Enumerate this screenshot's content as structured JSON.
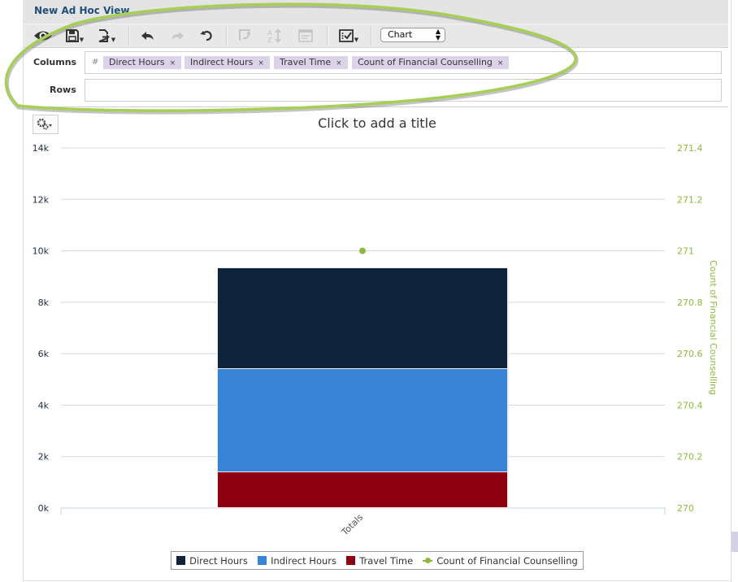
{
  "window": {
    "title": "New Ad Hoc View"
  },
  "toolbar": {
    "buttons": [
      {
        "name": "view-icon",
        "label": "Display mode"
      },
      {
        "name": "save-icon",
        "label": "Save"
      },
      {
        "name": "export-icon",
        "label": "Export"
      },
      {
        "name": "undo-icon",
        "label": "Undo"
      },
      {
        "name": "redo-icon",
        "label": "Redo"
      },
      {
        "name": "reset-icon",
        "label": "Undo all"
      },
      {
        "name": "pivot-icon",
        "label": "Pivot"
      },
      {
        "name": "sort-icon",
        "label": "Sort"
      },
      {
        "name": "input-controls-icon",
        "label": "Input controls"
      },
      {
        "name": "options-icon",
        "label": "Options"
      }
    ],
    "view_type": {
      "selected": "Chart"
    }
  },
  "shelves": {
    "columns_label": "Columns",
    "rows_label": "Rows",
    "columns_marker": "#",
    "columns": [
      {
        "label": "Direct Hours",
        "remove": "×"
      },
      {
        "label": "Indirect Hours",
        "remove": "×"
      },
      {
        "label": "Travel Time",
        "remove": "×"
      },
      {
        "label": "Count of Financial Counselling",
        "remove": "×"
      }
    ],
    "rows": []
  },
  "chart_title_placeholder": "Click to add a title",
  "chart_data": {
    "type": "bar",
    "stacked": true,
    "title": "Click to add a title",
    "categories": [
      "Totals"
    ],
    "series": [
      {
        "name": "Direct Hours",
        "type": "bar",
        "axis": "left",
        "color": "#0f233a",
        "values": [
          3919
        ]
      },
      {
        "name": "Indirect Hours",
        "type": "bar",
        "axis": "left",
        "color": "#3883d6",
        "values": [
          4014
        ]
      },
      {
        "name": "Travel Time",
        "type": "bar",
        "axis": "left",
        "color": "#8c0010",
        "values": [
          1390
        ]
      },
      {
        "name": "Count of Financial Counselling",
        "type": "line",
        "axis": "right",
        "color": "#8cba3c",
        "values": [
          271
        ]
      }
    ],
    "left_axis": {
      "min": 0,
      "max": 14000,
      "ticks": [
        0,
        2000,
        4000,
        6000,
        8000,
        10000,
        12000,
        14000
      ],
      "tick_labels": [
        "0k",
        "2k",
        "4k",
        "6k",
        "8k",
        "10k",
        "12k",
        "14k"
      ],
      "label": ""
    },
    "right_axis": {
      "min": 270,
      "max": 271.4,
      "ticks": [
        270,
        270.2,
        270.4,
        270.6,
        270.8,
        271,
        271.2,
        271.4
      ],
      "tick_labels": [
        "270",
        "270.2",
        "270.4",
        "270.6",
        "270.8",
        "271",
        "271.2",
        "271.4"
      ],
      "label": "Count of Financial Counselling",
      "color": "#8cba3c"
    },
    "xlabel": "",
    "grid": true,
    "legend_position": "bottom-center",
    "legend": [
      "Direct Hours",
      "Indirect Hours",
      "Travel Time",
      "Count of Financial Counselling"
    ]
  },
  "annotation": {
    "type": "ellipse-highlight",
    "color": "#8cc43f"
  }
}
